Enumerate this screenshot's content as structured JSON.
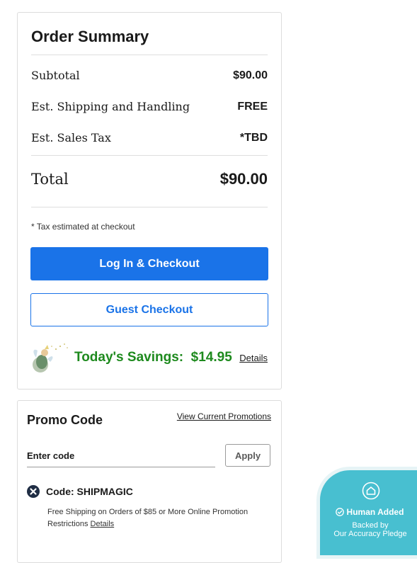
{
  "summary": {
    "title": "Order Summary",
    "subtotal_label": "Subtotal",
    "subtotal_value": "$90.00",
    "shipping_label": "Est. Shipping and Handling",
    "shipping_value": "FREE",
    "tax_label": "Est. Sales Tax",
    "tax_value": "*TBD",
    "total_label": "Total",
    "total_value": "$90.00",
    "tax_note": "* Tax estimated at checkout",
    "login_checkout_label": "Log In & Checkout",
    "guest_checkout_label": "Guest Checkout",
    "savings_label": "Today's Savings:",
    "savings_value": "$14.95",
    "savings_details_label": "Details",
    "primary_color": "#1a73e8",
    "savings_color": "#1e8a1e"
  },
  "promo": {
    "title": "Promo Code",
    "view_promotions_label": "View Current Promotions",
    "input_placeholder": "Enter code",
    "apply_label": "Apply",
    "applied_code_label": "Code: SHIPMAGIC",
    "applied_code_description": "Free Shipping on Orders of $85 or More Online Promotion Restrictions",
    "applied_code_details_label": "Details",
    "remove_icon": "remove-circle-icon"
  },
  "pledge_badge": {
    "icon": "home-badge-icon",
    "status_label": "Human Added",
    "line1": "Backed by",
    "line2": "Our Accuracy Pledge",
    "color": "#48bfd0"
  }
}
